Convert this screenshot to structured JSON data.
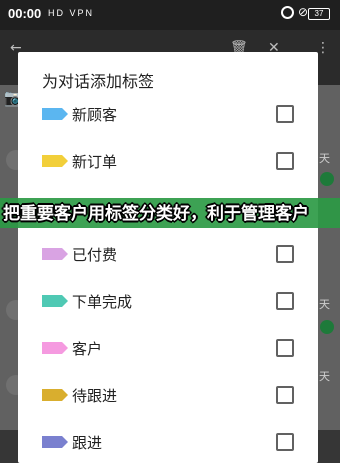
{
  "status_bar": {
    "time": "00:00",
    "signal_glyphs": "HD VPN",
    "battery": "37",
    "icons": [
      "alarm-icon",
      "wifi-off-icon",
      "battery-icon"
    ]
  },
  "background": {
    "side_labels": [
      "天",
      "天",
      "天"
    ]
  },
  "dialog": {
    "title": "为对话添加标签",
    "items": [
      {
        "label": "新顾客",
        "color": "#5bb6f0",
        "checked": false
      },
      {
        "label": "新订单",
        "color": "#f2cf3a",
        "checked": false
      },
      {
        "label": "已付费",
        "color": "#d9a3e3",
        "checked": false
      },
      {
        "label": "下单完成",
        "color": "#4fc9b4",
        "checked": false
      },
      {
        "label": "客户",
        "color": "#f59ae0",
        "checked": false
      },
      {
        "label": "待跟进",
        "color": "#d9ae2e",
        "checked": false
      },
      {
        "label": "跟进",
        "color": "#7a80cf",
        "checked": false
      }
    ]
  },
  "banner": {
    "text": "把重要客户用标签分类好，利于管理客户",
    "color": "#2d9a45"
  }
}
